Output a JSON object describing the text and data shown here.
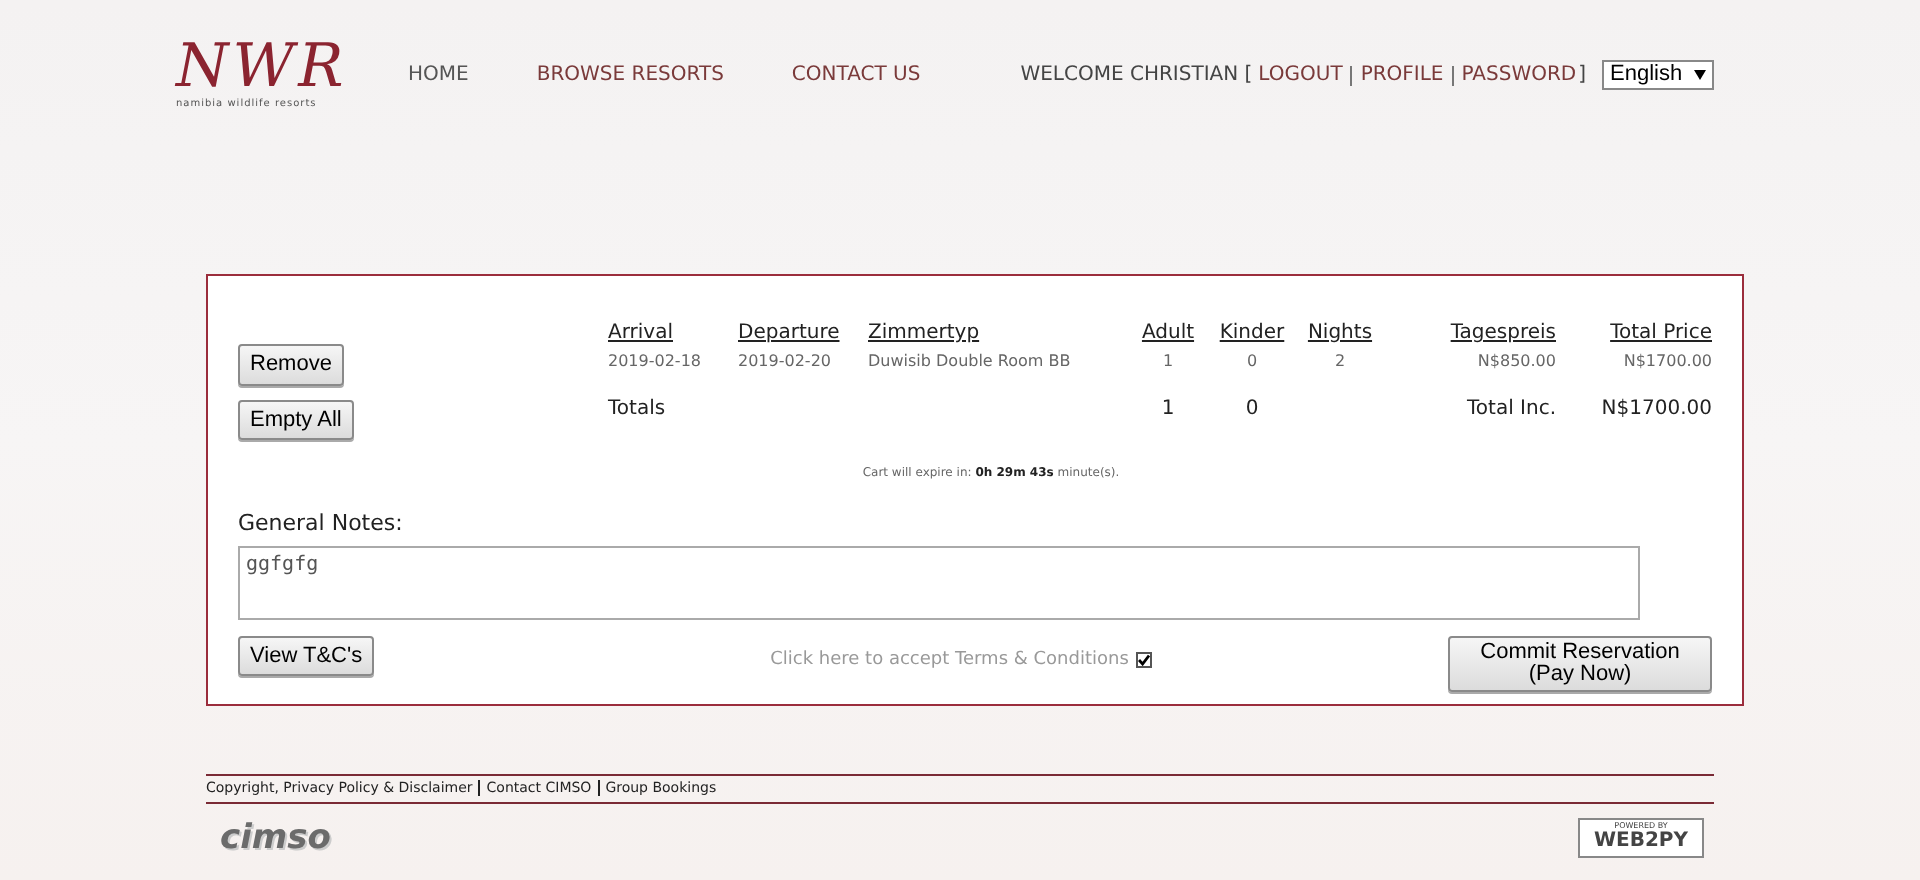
{
  "logo": {
    "mark": "NWR",
    "tagline": "namibia wildlife resorts"
  },
  "nav": [
    "HOME",
    "BROWSE RESORTS",
    "CONTACT US"
  ],
  "user": {
    "welcome": "WELCOME CHRISTIAN [",
    "links": [
      "LOGOUT",
      "PROFILE",
      "PASSWORD"
    ],
    "close": "]"
  },
  "language": {
    "value": "English"
  },
  "cart": {
    "columns": [
      "Arrival",
      "Departure",
      "Zimmertyp",
      "Adult",
      "Kinder",
      "Nights",
      "Tagespreis",
      "Total Price"
    ],
    "rows": [
      {
        "button": "Remove",
        "cells": [
          "2019-02-18",
          "2019-02-20",
          "Duwisib Double Room BB",
          "1",
          "0",
          "2",
          "N$850.00",
          "N$1700.00"
        ]
      }
    ],
    "totals": {
      "button": "Empty All",
      "label": "Totals",
      "adult": "1",
      "kinder": "0",
      "total_label": "Total Inc.",
      "total": "N$1700.00"
    },
    "expiry": {
      "prefix": "Cart will expire in:",
      "time": "0h 29m 43s",
      "suffix": "minute(s)."
    },
    "notes_label": "General Notes:",
    "notes_value": "ggfgfg",
    "tc_button": "View T&C's",
    "accept_label": "Click here to accept Terms & Conditions",
    "accept_checked": true,
    "commit_button": "Commit Reservation (Pay Now)"
  },
  "footer": {
    "links": [
      "Copyright, Privacy Policy & Disclaimer",
      "Contact CIMSO",
      "Group Bookings"
    ],
    "cimso": "cimso",
    "powered": "POWERED BY",
    "web2py": "WEB2PY"
  }
}
